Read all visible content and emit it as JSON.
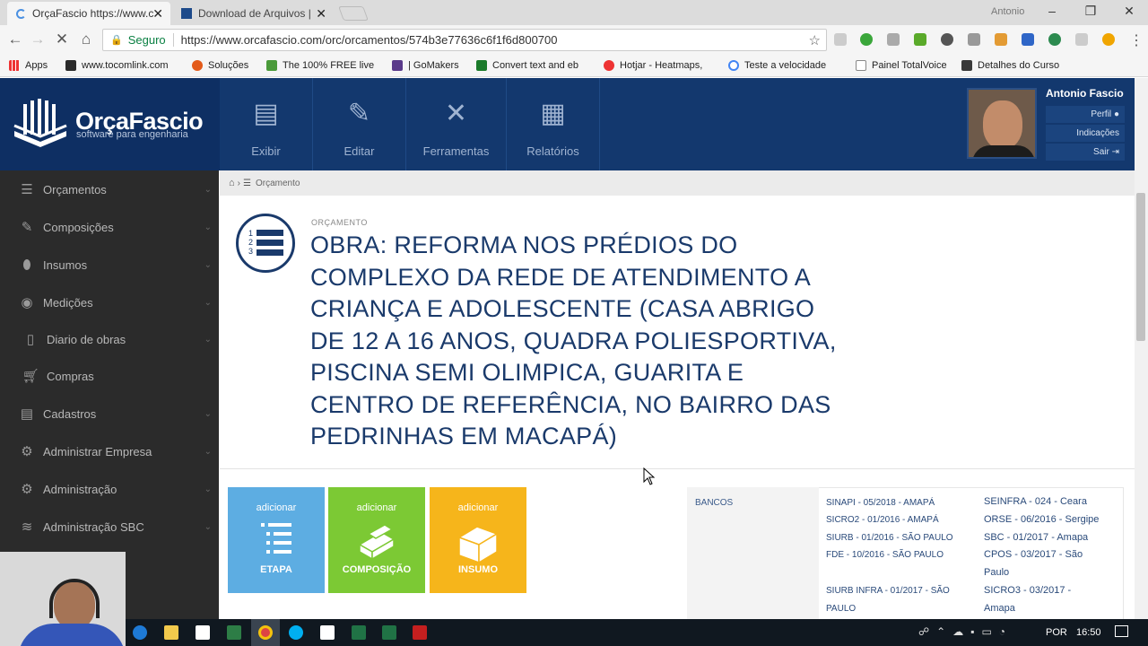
{
  "browser": {
    "tabs": [
      {
        "title": "OrçaFascio https://www.c",
        "active": true
      },
      {
        "title": "Download de Arquivos |",
        "active": false
      }
    ],
    "window_user": "Antonio",
    "address": {
      "secure_label": "Seguro",
      "url": "https://www.orcafascio.com/orc/orcamentos/574b3e77636c6f1f6d800700"
    },
    "bookmarks": [
      "Apps",
      "www.tocomlink.com",
      "Soluções",
      "The 100% FREE live",
      "| GoMakers",
      "Convert text and eb",
      "Hotjar - Heatmaps,",
      "Teste a velocidade",
      "Painel TotalVoice",
      "Detalhes do Curso"
    ]
  },
  "app": {
    "logo": {
      "name": "OrçaFascio",
      "tagline": "software para engenharia"
    },
    "header_buttons": [
      "Exibir",
      "Editar",
      "Ferramentas",
      "Relatórios"
    ],
    "user": {
      "name": "Antonio Fascio",
      "links": [
        "Perfil",
        "Indicações",
        "Sair"
      ]
    },
    "sidebar": [
      {
        "label": "Orçamentos",
        "icon": "list-icon"
      },
      {
        "label": "Composições",
        "icon": "pencil-icon"
      },
      {
        "label": "Insumos",
        "icon": "pill-icon"
      },
      {
        "label": "Medições",
        "icon": "measure-icon"
      },
      {
        "label": "Diario de obras",
        "icon": "book-icon"
      },
      {
        "label": "Compras",
        "icon": "cart-icon"
      },
      {
        "label": "Cadastros",
        "icon": "clipboard-icon"
      },
      {
        "label": "Administrar Empresa",
        "icon": "gear-icon"
      },
      {
        "label": "Administração",
        "icon": "gears-icon"
      },
      {
        "label": "Administração SBC",
        "icon": "database-icon"
      }
    ],
    "breadcrumb": "Orçamento",
    "section_label": "ORÇAMENTO",
    "title": "OBRA: REFORMA NOS PRÉDIOS DO COMPLEXO DA REDE DE ATENDIMENTO A CRIANÇA E ADOLESCENTE (CASA ABRIGO DE 12 A 16 ANOS, QUADRA POLIESPORTIVA, PISCINA SEMI OLIMPICA, GUARITA E CENTRO DE REFERÊNCIA, NO BAIRRO DAS PEDRINHAS EM MACAPÁ)",
    "add_cards": [
      {
        "top": "adicionar",
        "bottom": "ETAPA",
        "color": "#5dade2"
      },
      {
        "top": "adicionar",
        "bottom": "COMPOSIÇÃO",
        "color": "#7cc934"
      },
      {
        "top": "adicionar",
        "bottom": "INSUMO",
        "color": "#f6b51b"
      }
    ],
    "bancos": {
      "label": "BANCOS",
      "col1": [
        "SINAPI - 05/2018 - AMAPÁ",
        "SICRO2 - 01/2016 - AMAPÁ",
        "SIURB - 01/2016 - SÃO PAULO",
        "FDE - 10/2016 - SÃO PAULO",
        "SIURB INFRA - 01/2017 - SÃO PAULO"
      ],
      "col2": [
        "SEINFRA - 024 - Ceara",
        "ORSE - 06/2016 - Sergipe",
        "SBC - 01/2017 - Amapa",
        "CPOS - 03/2017 - São Paulo",
        "SICRO3 - 03/2017 - Amapa"
      ]
    }
  },
  "taskbar": {
    "language": "POR",
    "time": "16:50"
  }
}
